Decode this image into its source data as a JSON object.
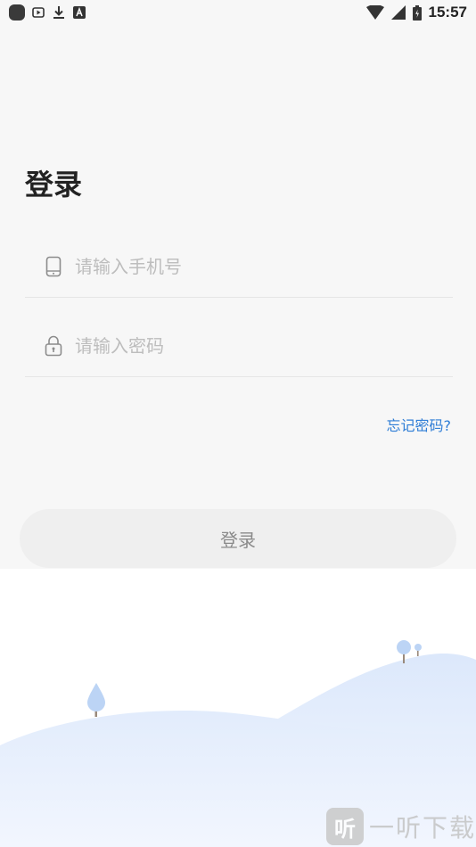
{
  "status_bar": {
    "time": "15:57",
    "left_icons": [
      "app-icon",
      "media-icon",
      "download-icon",
      "font-icon"
    ],
    "right_icons": [
      "wifi-icon",
      "signal-icon",
      "battery-icon"
    ]
  },
  "login": {
    "title": "登录",
    "phone_placeholder": "请输入手机号",
    "password_placeholder": "请输入密码",
    "forgot_label": "忘记密码?",
    "submit_label": "登录"
  },
  "watermark": {
    "badge": "听",
    "text": "一听下载"
  },
  "colors": {
    "accent": "#2e7dd6",
    "background": "#f7f7f7",
    "button_bg": "#efefef"
  }
}
